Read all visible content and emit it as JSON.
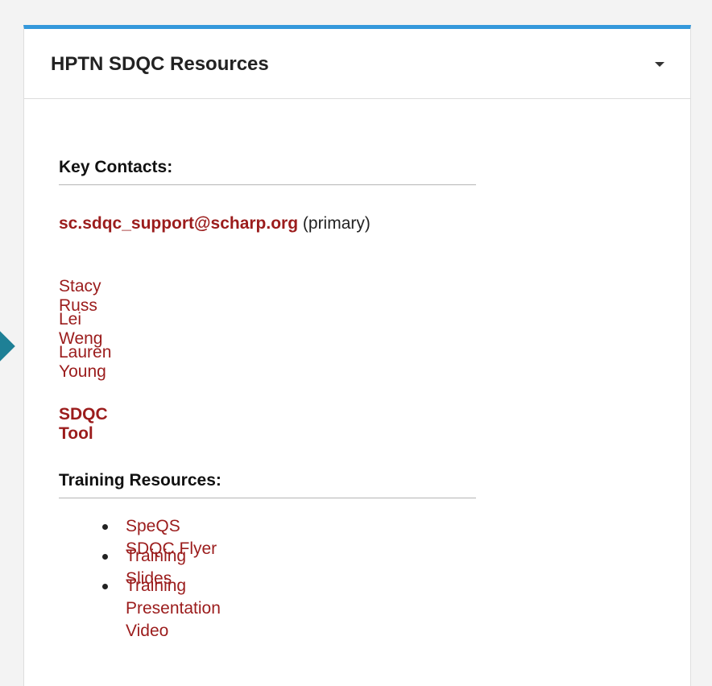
{
  "panel": {
    "title": "HPTN SDQC Resources",
    "toggle_icon": "caret-down-icon",
    "accent_color": "#3498db"
  },
  "key_contacts": {
    "heading": "Key Contacts:",
    "primary_email": "sc.sdqc_support@scharp.org",
    "primary_note": "(primary)",
    "contacts": [
      "Stacy Russ",
      "Lei Weng",
      "Lauren Young"
    ]
  },
  "tool": {
    "label": "SDQC Tool"
  },
  "training": {
    "heading": "Training Resources:",
    "items": [
      "SpeQS SDQC Flyer",
      "Training Slides",
      "Training Presentation Video"
    ]
  },
  "colors": {
    "link": "#9b1c1c",
    "side_arrow": "#1e8096"
  }
}
